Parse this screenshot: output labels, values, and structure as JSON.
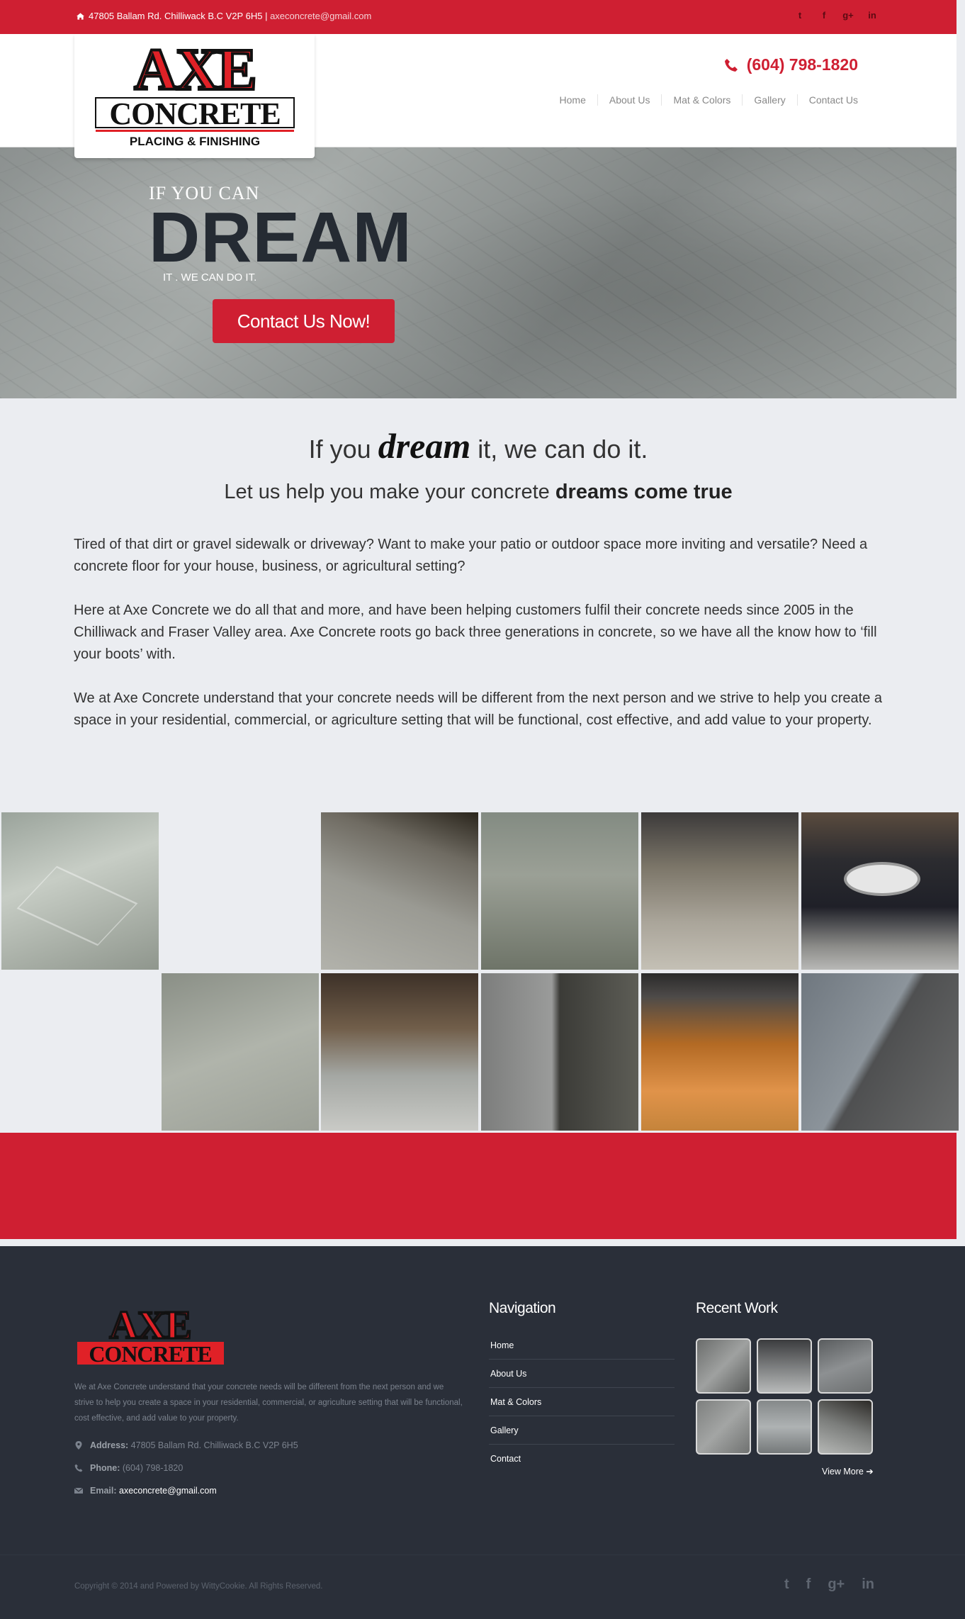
{
  "topbar": {
    "address": "47805 Ballam Rd. Chilliwack B.C V2P 6H5",
    "separator": "|",
    "email": "axeconcrete@gmail.com",
    "social": [
      "twitter-icon",
      "facebook-icon",
      "googleplus-icon",
      "linkedin-icon"
    ],
    "social_glyphs": {
      "twitter": "t",
      "facebook": "f",
      "googleplus": "g+",
      "linkedin": "in"
    }
  },
  "header": {
    "logo": {
      "top": "AXE",
      "middle": "CONCRETE",
      "bottom": "PLACING & FINISHING"
    },
    "phone": "(604) 798-1820",
    "nav": [
      "Home",
      "About Us",
      "Mat & Colors",
      "Gallery",
      "Contact Us"
    ]
  },
  "hero": {
    "line1": "IF YOU CAN",
    "big": "DREAM",
    "line3": "IT . WE CAN DO IT.",
    "cta": "Contact Us Now!"
  },
  "intro": {
    "h1_pre": "If you ",
    "h1_em": "dream",
    "h1_post": " it, we can do it.",
    "h2_pre": "Let us help you make your concrete ",
    "h2_bold": "dreams come true",
    "p1": "Tired of that dirt or gravel sidewalk or driveway? Want to make your patio or outdoor space more inviting and versatile? Need a concrete floor for your house, business, or agricultural setting?",
    "p2": "Here at Axe Concrete we do all that and more, and have been helping customers fulfil their concrete needs since 2005 in the Chilliwack and Fraser Valley area. Axe Concrete roots go back three generations in concrete, so we have all the know how to ‘fill your boots’ with.",
    "p3": "We at Axe Concrete understand that your concrete needs will be different from the next person and we strive to help you create a space in your residential, commercial, or agriculture setting that will be functional, cost effective, and add value to your property."
  },
  "footer": {
    "logo": {
      "top": "AXE",
      "middle": "CONCRETE"
    },
    "description": "We at Axe Concrete understand that your concrete needs will be different from the next person and we strive to help you create a space in your residential, commercial, or agriculture setting that will be functional, cost effective, and add value to your property.",
    "address_label": "Address:",
    "address": "47805 Ballam Rd. Chilliwack B.C V2P 6H5",
    "phone_label": "Phone:",
    "phone": "(604) 798-1820",
    "email_label": "Email:",
    "email": "axeconcrete@gmail.com",
    "nav_title": "Navigation",
    "nav": [
      "Home",
      "About Us",
      "Mat & Colors",
      "Gallery",
      "Contact"
    ],
    "recent_title": "Recent Work",
    "view_more": "View More ➔",
    "copyright": "Copyright © 2014 and Powered by WittyCookie. All Rights Reserved."
  },
  "colors": {
    "brand_red": "#cf1f32",
    "footer_bg": "#2a2f39",
    "page_bg": "#ebedf1"
  }
}
